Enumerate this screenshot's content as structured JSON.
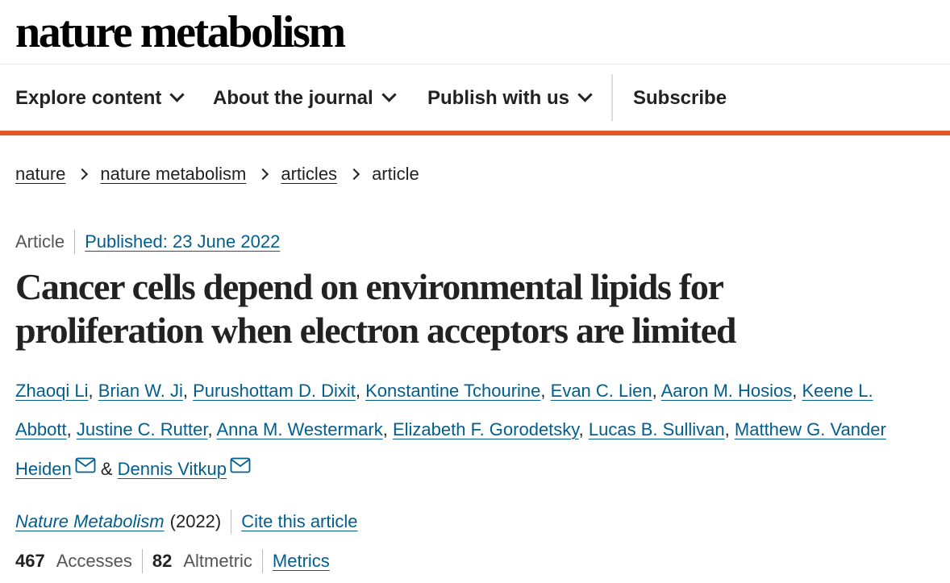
{
  "site": {
    "brand": "nature metabolism"
  },
  "nav": {
    "explore": "Explore content",
    "about": "About the journal",
    "publish": "Publish with us",
    "subscribe": "Subscribe"
  },
  "breadcrumb": [
    "nature",
    "nature metabolism",
    "articles",
    "article"
  ],
  "article": {
    "type": "Article",
    "published": "Published: 23 June 2022",
    "title": "Cancer cells depend on environmental lipids for proliferation when electron acceptors are limited",
    "authors": [
      "Zhaoqi Li",
      "Brian W. Ji",
      "Purushottam D. Dixit",
      "Konstantine Tchourine",
      "Evan C. Lien",
      "Aaron M. Hosios",
      "Keene L. Abbott",
      "Justine C. Rutter",
      "Anna M. Westermark",
      "Elizabeth F. Gorodetsky",
      "Lucas B. Sullivan",
      "Matthew G. Vander Heiden",
      "Dennis Vitkup"
    ],
    "author_conjunction": "&",
    "journal": "Nature Metabolism",
    "year": "(2022)",
    "cite": "Cite this article",
    "accesses_count": "467",
    "accesses_label": "Accesses",
    "altmetric_count": "82",
    "altmetric_label": "Altmetric",
    "metrics": "Metrics"
  },
  "colors": {
    "accent_bar": "#e05b2a",
    "link": "#025e8d"
  },
  "icons": [
    "chevron-down-icon",
    "chevron-right-icon",
    "mail-icon"
  ]
}
